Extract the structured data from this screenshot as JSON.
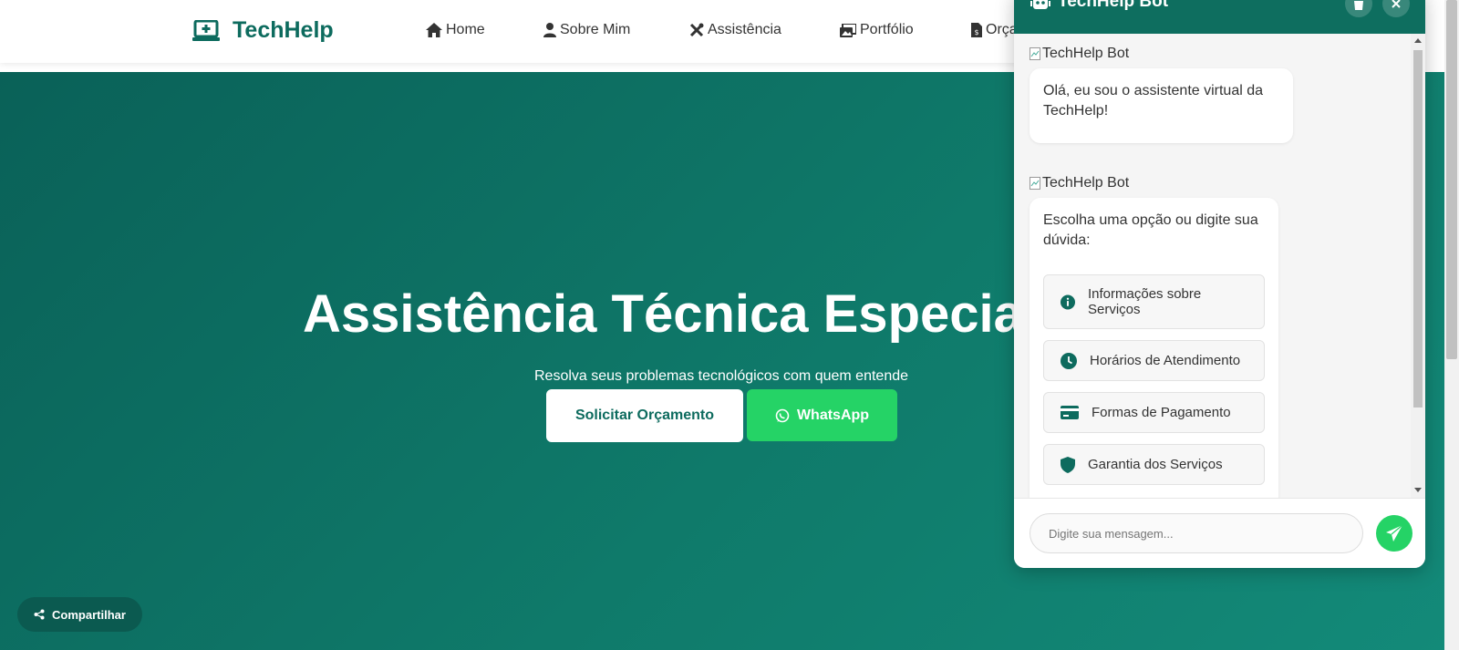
{
  "navbar": {
    "brand": "TechHelp",
    "items": [
      {
        "label": "Home",
        "icon": "home-icon"
      },
      {
        "label": "Sobre Mim",
        "icon": "user-icon"
      },
      {
        "label": "Assistência",
        "icon": "tools-icon"
      },
      {
        "label": "Portfólio",
        "icon": "images-icon"
      },
      {
        "label": "Orça",
        "icon": "invoice-icon"
      }
    ]
  },
  "hero": {
    "title": "Assistência Técnica Especial",
    "subtitle": "Resolva seus problemas tecnológicos com quem entende",
    "quote_button": "Solicitar Orçamento",
    "whatsapp_button": "WhatsApp"
  },
  "share": {
    "label": "Compartilhar"
  },
  "chat": {
    "title": "TechHelp Bot",
    "messages": [
      {
        "avatar_alt": "TechHelp Bot",
        "text": "Olá, eu sou o assistente virtual da TechHelp!"
      },
      {
        "avatar_alt": "TechHelp Bot",
        "text": "Escolha uma opção ou digite sua dúvida:"
      }
    ],
    "options": [
      {
        "label": "Informações sobre Serviços",
        "icon": "info-icon"
      },
      {
        "label": "Horários de Atendimento",
        "icon": "clock-icon"
      },
      {
        "label": "Formas de Pagamento",
        "icon": "credit-card-icon"
      },
      {
        "label": "Garantia dos Serviços",
        "icon": "shield-icon"
      }
    ],
    "input_placeholder": "Digite sua mensagem..."
  },
  "colors": {
    "primary": "#0d6b5e",
    "hero_start": "#0a6158",
    "hero_end": "#138a79",
    "whatsapp": "#25d366"
  }
}
